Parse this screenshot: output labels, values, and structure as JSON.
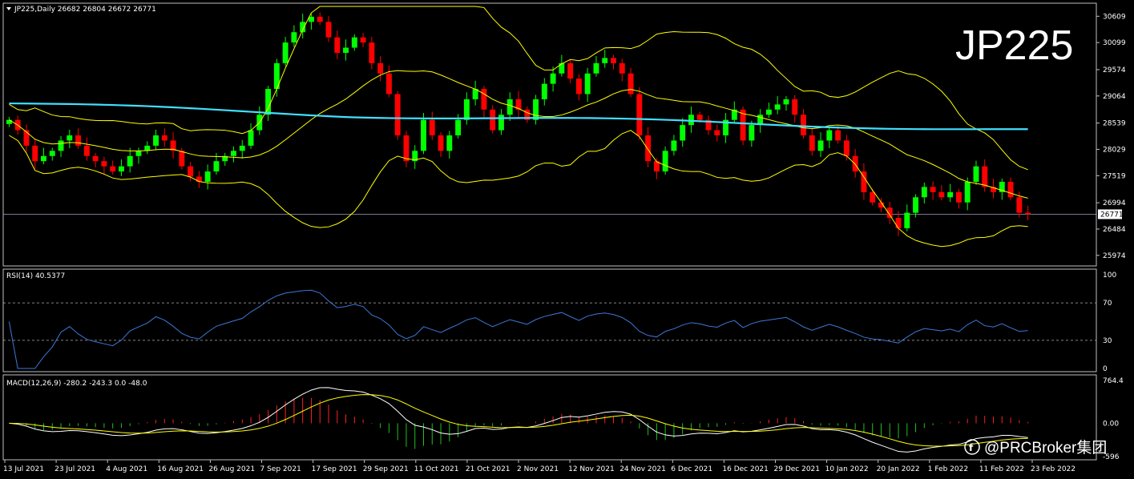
{
  "header": {
    "symbol_line": "JP225,Daily  26682 26804 26672 26771",
    "big_title": "JP225",
    "rsi_label": "RSI(14) 40.5377",
    "macd_label": "MACD(12,26,9) -280.2 -243.3 0.0 -48.0",
    "current_price_tag": "26771",
    "watermark": "@PRCBroker集团"
  },
  "colors": {
    "background": "#000000",
    "bull_candle": "#00ff00",
    "bear_candle": "#ff0000",
    "bollinger": "#ffff00",
    "ma": "#40e0ff",
    "rsi_line": "#3c78d8",
    "macd_hist_pos": "#ff2020",
    "macd_hist_neg": "#20c020",
    "macd_line": "#ffffff",
    "signal_line": "#ffff00",
    "grid_border": "#c0c0c0"
  },
  "chart_data": [
    {
      "type": "candlestick",
      "panel": "price",
      "ylim": [
        25800,
        30800
      ],
      "y_ticks": [
        "30609",
        "30099",
        "29574",
        "29064",
        "28539",
        "28029",
        "27519",
        "26994",
        "26484",
        "25974"
      ],
      "y_tick_values": [
        30609,
        30099,
        29574,
        29064,
        28539,
        28029,
        27519,
        26994,
        26484,
        25974
      ],
      "x_labels": [
        "13 Jul 2021",
        "23 Jul 2021",
        "4 Aug 2021",
        "16 Aug 2021",
        "26 Aug 2021",
        "7 Sep 2021",
        "17 Sep 2021",
        "29 Sep 2021",
        "11 Oct 2021",
        "21 Oct 2021",
        "2 Nov 2021",
        "12 Nov 2021",
        "24 Nov 2021",
        "6 Dec 2021",
        "16 Dec 2021",
        "29 Dec 2021",
        "10 Jan 2022",
        "20 Jan 2022",
        "1 Feb 2022",
        "11 Feb 2022",
        "23 Feb 2022"
      ],
      "closes": [
        28600,
        28400,
        28100,
        27800,
        27900,
        28000,
        28200,
        28300,
        28100,
        27900,
        27800,
        27700,
        27600,
        27700,
        27900,
        28000,
        28100,
        28300,
        28200,
        28000,
        27700,
        27500,
        27400,
        27600,
        27800,
        27900,
        28000,
        28100,
        28400,
        28700,
        29200,
        29700,
        30100,
        30300,
        30500,
        30600,
        30500,
        30200,
        29900,
        30000,
        30200,
        30100,
        29700,
        29500,
        29100,
        28300,
        27800,
        28000,
        28600,
        28300,
        28000,
        28300,
        28600,
        29000,
        29200,
        28800,
        28400,
        28700,
        29000,
        28800,
        28600,
        29000,
        29300,
        29500,
        29700,
        29400,
        29100,
        29500,
        29700,
        29800,
        29700,
        29500,
        29100,
        28300,
        27800,
        27600,
        28000,
        28200,
        28500,
        28700,
        28600,
        28400,
        28300,
        28600,
        28800,
        28200,
        28500,
        28700,
        28800,
        28900,
        29000,
        28700,
        28300,
        28000,
        28200,
        28400,
        28200,
        27900,
        27600,
        27200,
        27000,
        26900,
        26700,
        26500,
        26800,
        27100,
        27300,
        27200,
        27100,
        27200,
        27000,
        27400,
        27700,
        27300,
        27200,
        27400,
        27100,
        26800,
        26771
      ],
      "ma_series": [
        28920,
        28690,
        28560,
        28400
      ],
      "rsi": {
        "levels": [
          30,
          70
        ],
        "ylim": [
          0,
          100
        ],
        "y_ticks": [
          "100",
          "70",
          "30",
          "0"
        ],
        "last": 40.5377
      },
      "macd": {
        "fast": 12,
        "slow": 26,
        "signal": 9,
        "y_ticks": [
          "764.4",
          "0.00",
          "-596"
        ],
        "ylim": [
          -596,
          764.4
        ],
        "main": -280.2,
        "signal_value": -243.3
      }
    }
  ]
}
